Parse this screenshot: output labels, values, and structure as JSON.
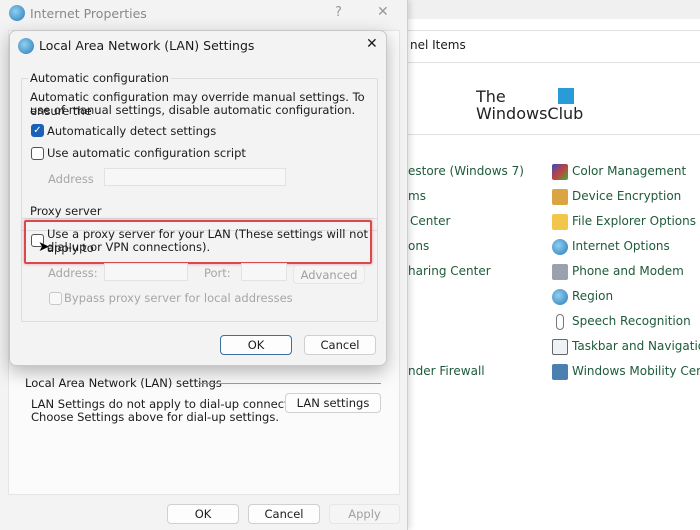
{
  "control_panel": {
    "breadcrumb": "nel Items",
    "logo": {
      "line1": "The",
      "line2": "WindowsClub"
    },
    "left_items": [
      "estore (Windows 7)",
      "ms",
      "Center",
      "ons",
      "haring Center",
      "nder Firewall"
    ],
    "right_items": [
      {
        "label": "Color Management",
        "icon": "color-management-icon"
      },
      {
        "label": "Device Encryption",
        "icon": "device-encryption-icon"
      },
      {
        "label": "File Explorer Options",
        "icon": "file-explorer-options-icon"
      },
      {
        "label": "Internet Options",
        "icon": "internet-options-icon"
      },
      {
        "label": "Phone and Modem",
        "icon": "phone-modem-icon"
      },
      {
        "label": "Region",
        "icon": "region-icon"
      },
      {
        "label": "Speech Recognition",
        "icon": "microphone-icon"
      },
      {
        "label": "Taskbar and Navigation",
        "icon": "taskbar-icon"
      },
      {
        "label": "Windows Mobility Cente",
        "icon": "mobility-center-icon"
      }
    ],
    "link_color": "#1e5a3a"
  },
  "internet_properties": {
    "title": "Internet Properties",
    "help": "?",
    "close": "✕",
    "lan_section_label": "Local Area Network (LAN) settings",
    "lan_text_1": "LAN Settings do not apply to dial-up connections.",
    "lan_text_2": "Choose Settings above for dial-up settings.",
    "lan_button": "LAN settings",
    "ok": "OK",
    "cancel": "Cancel",
    "apply": "Apply"
  },
  "lan_dialog": {
    "title": "Local Area Network (LAN) Settings",
    "close": "✕",
    "auto_group": "Automatic configuration",
    "auto_desc_1": "Automatic configuration may override manual settings.  To ensure the",
    "auto_desc_2": "use of manual settings, disable automatic configuration.",
    "auto_detect": {
      "label": "Automatically detect settings",
      "checked": true
    },
    "auto_script": {
      "label": "Use automatic configuration script",
      "checked": false
    },
    "address_label": "Address",
    "proxy_group": "Proxy server",
    "use_proxy": {
      "label_1": "Use a proxy server for your LAN (These settings will not apply to",
      "label_2": "dial-up or VPN connections).",
      "checked": false
    },
    "proxy_address_label": "Address:",
    "port_label": "Port:",
    "advanced": "Advanced",
    "bypass": {
      "label": "Bypass proxy server for local addresses",
      "checked": false
    },
    "ok": "OK",
    "cancel": "Cancel",
    "highlight_color": "#d8484d",
    "accent": "#1a62b8"
  }
}
